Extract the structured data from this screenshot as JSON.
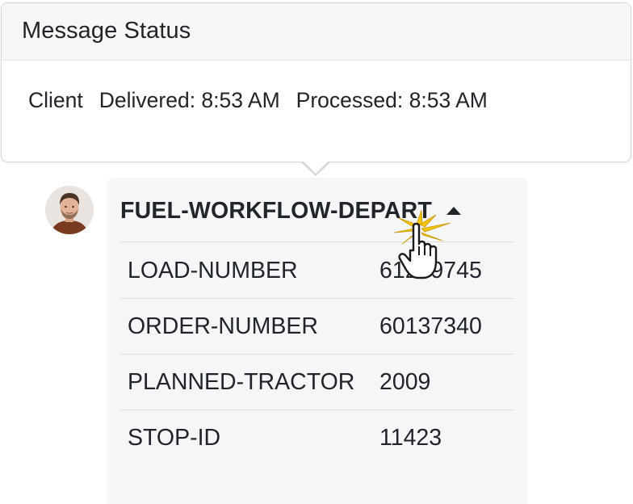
{
  "popover": {
    "title": "Message Status",
    "client_label": "Client",
    "delivered": "Delivered: 8:53 AM",
    "processed": "Processed: 8:53 AM"
  },
  "message": {
    "title": "FUEL-WORKFLOW-DEPART",
    "expanded": true,
    "fields": [
      {
        "key": "LOAD-NUMBER",
        "value": "61209745"
      },
      {
        "key": "ORDER-NUMBER",
        "value": "60137340"
      },
      {
        "key": "PLANNED-TRACTOR",
        "value": "2009"
      },
      {
        "key": "STOP-ID",
        "value": "11423"
      }
    ]
  },
  "icons": {
    "avatar": "user-avatar-photo",
    "caret": "caret-up-icon",
    "cursor": "hand-pointer-click-cursor"
  },
  "colors": {
    "text": "#212529",
    "card_bg": "#f5f6f8",
    "popover_header_bg": "#f7f7f7",
    "border": "#d4d6d9",
    "click_burst": "#f2c500"
  }
}
